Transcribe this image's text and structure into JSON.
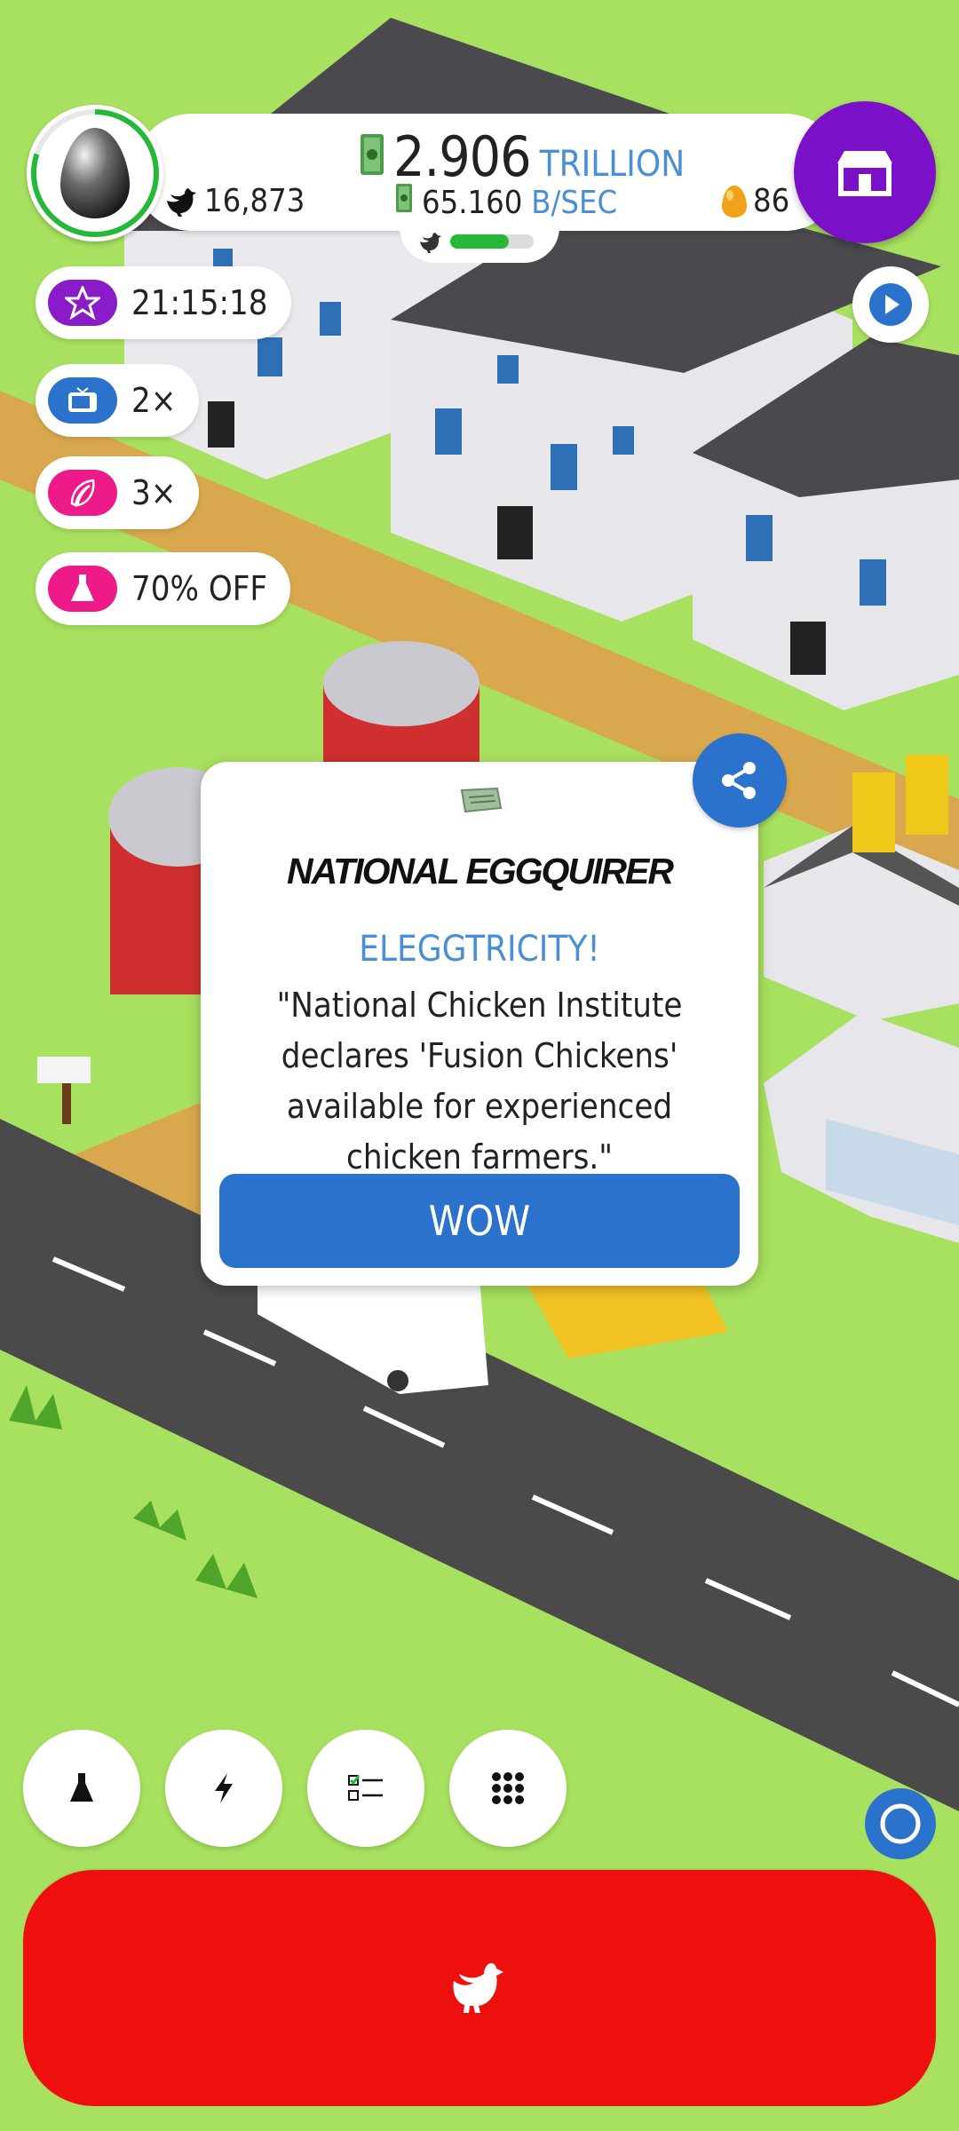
{
  "stats": {
    "money_value": "2.906",
    "money_unit": "TRILLION",
    "rate_value": "65.160",
    "rate_unit": "B/SEC",
    "chicken_count": "16,873",
    "egg_count": "86",
    "hatchery_fill": 0.7,
    "egg_progress": 0.8
  },
  "boosts": [
    {
      "icon": "star-icon",
      "label": "21:15:18",
      "color": "#8a1bc9"
    },
    {
      "icon": "tv-icon",
      "label": "2×",
      "color": "#2a72cc"
    },
    {
      "icon": "feather-icon",
      "label": "3×",
      "color": "#ee1a8a"
    },
    {
      "icon": "flask-icon",
      "label": "70% OFF",
      "color": "#ee1a8a"
    }
  ],
  "news": {
    "publication": "NATIONAL EGGQUIRER",
    "headline": "ELEGGTRICITY!",
    "body": "\"National Chicken Institute declares 'Fusion Chickens' available for experienced chicken farmers.\"",
    "button_label": "WOW"
  },
  "bottom_bar": {
    "buttons": [
      "research-icon",
      "boost-icon",
      "missions-icon",
      "menu-grid-icon"
    ],
    "hatch_button_icon": "chicken-icon"
  },
  "colors": {
    "grass": "#a8e05f",
    "road": "#4a4a4a",
    "dirt_path": "#d9a84e",
    "accent_blue": "#2a72cc",
    "shop_purple": "#7a11c9",
    "hatch_red": "#ee0f0f",
    "progress_green": "#26b83a"
  }
}
